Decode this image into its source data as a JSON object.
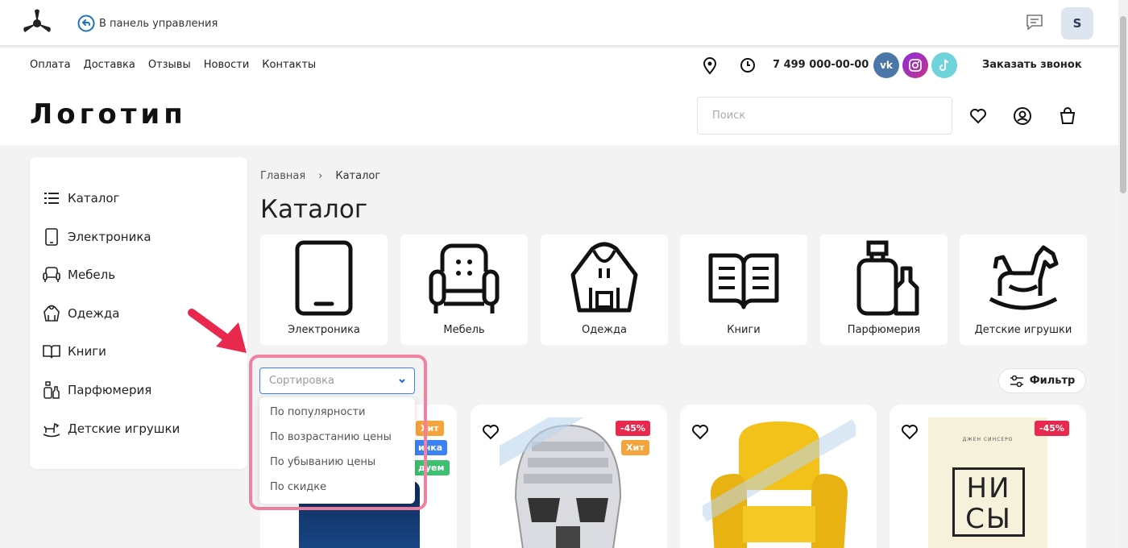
{
  "admin_bar": {
    "back_label": "В панель управления",
    "user_initial": "S"
  },
  "header": {
    "nav": [
      "Оплата",
      "Доставка",
      "Отзывы",
      "Новости",
      "Контакты"
    ],
    "phone": "7 499 000-00-00",
    "social": {
      "vk": "vk",
      "instagram": "instagram",
      "tiktok": "tiktok"
    },
    "callback_label": "Заказать звонок",
    "logo_text": "Логотип",
    "search_placeholder": "Поиск"
  },
  "sidebar": {
    "items": [
      {
        "label": "Каталог",
        "icon": "list-icon"
      },
      {
        "label": "Электроника",
        "icon": "tablet-icon"
      },
      {
        "label": "Мебель",
        "icon": "armchair-icon"
      },
      {
        "label": "Одежда",
        "icon": "hoodie-icon"
      },
      {
        "label": "Книги",
        "icon": "book-icon"
      },
      {
        "label": "Парфюмерия",
        "icon": "perfume-icon"
      },
      {
        "label": "Детские игрушки",
        "icon": "rocking-horse-icon"
      }
    ]
  },
  "breadcrumb": {
    "home": "Главная",
    "current": "Каталог"
  },
  "page_title": "Каталог",
  "categories": [
    {
      "label": "Электроника",
      "icon": "tablet-icon"
    },
    {
      "label": "Мебель",
      "icon": "armchair-icon"
    },
    {
      "label": "Одежда",
      "icon": "hoodie-icon"
    },
    {
      "label": "Книги",
      "icon": "book-icon"
    },
    {
      "label": "Парфюмерия",
      "icon": "perfume-icon"
    },
    {
      "label": "Детские игрушки",
      "icon": "rocking-horse-icon"
    }
  ],
  "sort": {
    "placeholder": "Сортировка",
    "options": [
      "По популярности",
      "По возрастанию цены",
      "По убыванию цены",
      "По скидке"
    ]
  },
  "filter_label": "Фильтр",
  "products": [
    {
      "badges": [
        "Хит",
        "инка",
        "дуем"
      ]
    },
    {
      "badges": [
        "-45%",
        "Хит"
      ]
    },
    {
      "badges": []
    },
    {
      "badges": [
        "-45%"
      ],
      "book_title": "НИ СЫ",
      "book_author": "ДЖЕН СИНСЕРО"
    }
  ],
  "colors": {
    "accent": "#3b82f6",
    "highlight": "#f1829f",
    "sale": "#e8284d",
    "hit": "#f4a33d"
  }
}
